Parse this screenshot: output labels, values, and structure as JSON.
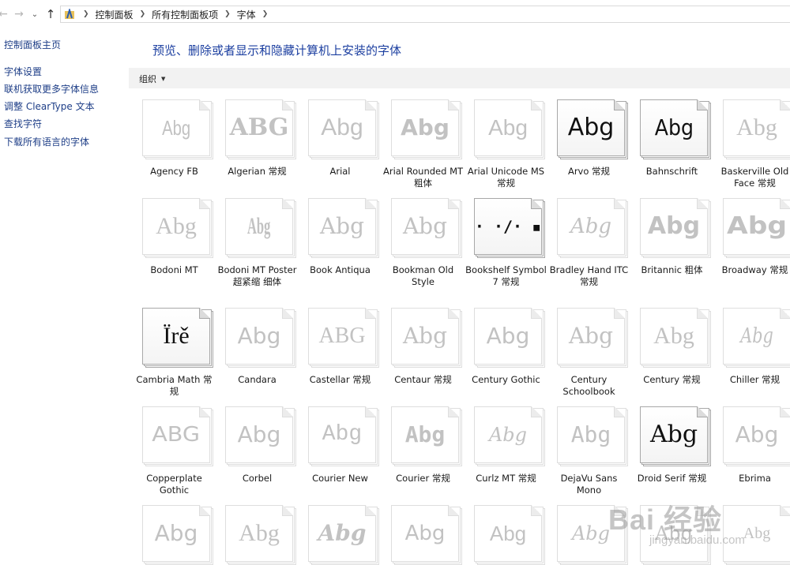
{
  "address_bar": {
    "crumbs": [
      "控制面板",
      "所有控制面板项",
      "字体"
    ]
  },
  "sidebar": {
    "items": [
      {
        "label": "控制面板主页"
      },
      {
        "label": "字体设置"
      },
      {
        "label": "联机获取更多字体信息"
      },
      {
        "label": "调整 ClearType 文本"
      },
      {
        "label": "查找字符"
      },
      {
        "label": "下载所有语言的字体"
      }
    ]
  },
  "main": {
    "title": "预览、删除或者显示和隐藏计算机上安装的字体",
    "organize_label": "组织"
  },
  "fonts": [
    {
      "name": "Agency FB",
      "sample": "Abg"
    },
    {
      "name": "Algerian 常规",
      "sample": "ABG"
    },
    {
      "name": "Arial",
      "sample": "Abg"
    },
    {
      "name": "Arial Rounded MT 粗体",
      "sample": "Abg"
    },
    {
      "name": "Arial Unicode MS 常规",
      "sample": "Abg"
    },
    {
      "name": "Arvo 常规",
      "sample": "Abg"
    },
    {
      "name": "Bahnschrift",
      "sample": "Abg"
    },
    {
      "name": "Baskerville Old Face 常规",
      "sample": "Abg"
    },
    {
      "name": "Bodoni MT",
      "sample": "Abg"
    },
    {
      "name": "Bodoni MT Poster 超紧缩 细体",
      "sample": "Abg"
    },
    {
      "name": "Book Antiqua",
      "sample": "Abg"
    },
    {
      "name": "Bookman Old Style",
      "sample": "Abg"
    },
    {
      "name": "Bookshelf Symbol 7 常规",
      "sample": "· ·∕·  ▪"
    },
    {
      "name": "Bradley Hand ITC 常规",
      "sample": "Abg"
    },
    {
      "name": "Britannic 粗体",
      "sample": "Abg"
    },
    {
      "name": "Broadway 常规",
      "sample": "Abg"
    },
    {
      "name": "Cambria Math 常规",
      "sample": "Ïrě"
    },
    {
      "name": "Candara",
      "sample": "Abg"
    },
    {
      "name": "Castellar 常规",
      "sample": "ABG"
    },
    {
      "name": "Centaur 常规",
      "sample": "Abg"
    },
    {
      "name": "Century Gothic",
      "sample": "Abg"
    },
    {
      "name": "Century Schoolbook",
      "sample": "Abg"
    },
    {
      "name": "Century 常规",
      "sample": "Abg"
    },
    {
      "name": "Chiller 常规",
      "sample": "Abg"
    },
    {
      "name": "Copperplate Gothic",
      "sample": "ABG"
    },
    {
      "name": "Corbel",
      "sample": "Abg"
    },
    {
      "name": "Courier New",
      "sample": "Abg"
    },
    {
      "name": "Courier 常规",
      "sample": "Abg"
    },
    {
      "name": "Curlz MT 常规",
      "sample": "Abg"
    },
    {
      "name": "DejaVu Sans Mono",
      "sample": "Abg"
    },
    {
      "name": "Droid Serif 常规",
      "sample": "Abg"
    },
    {
      "name": "Ebrima",
      "sample": "Abg"
    },
    {
      "name": "",
      "sample": "Abg"
    },
    {
      "name": "",
      "sample": "Abg"
    },
    {
      "name": "",
      "sample": "Abg"
    },
    {
      "name": "",
      "sample": "Abg"
    },
    {
      "name": "",
      "sample": "Abg"
    },
    {
      "name": "",
      "sample": "Abg"
    },
    {
      "name": "",
      "sample": "Abg"
    },
    {
      "name": "",
      "sample": "Abg"
    }
  ],
  "watermark": {
    "main": "Bai 经验",
    "sub": "jingyan.baidu.com"
  }
}
